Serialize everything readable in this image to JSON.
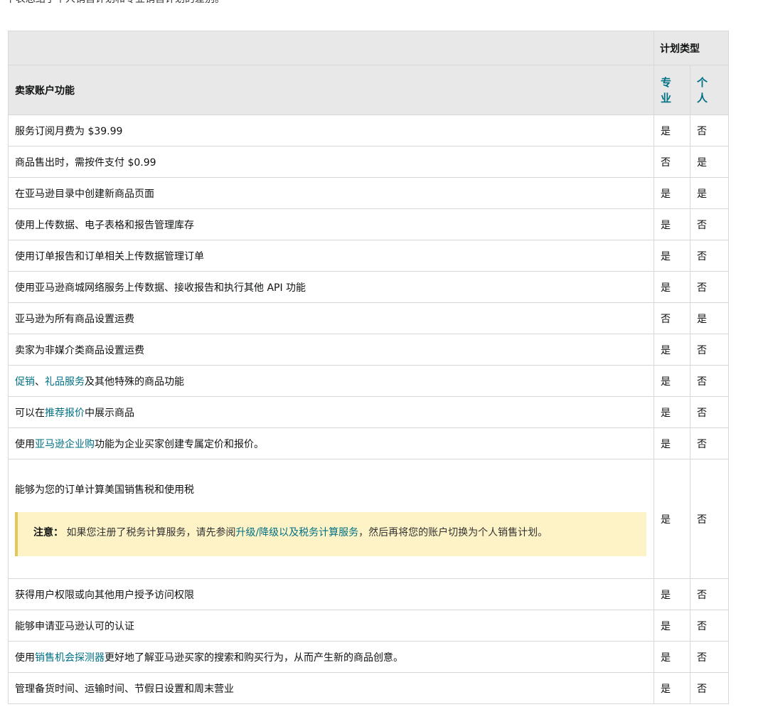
{
  "intro_text": "下表总结了个人销售计划和专业销售计划的差别。",
  "table": {
    "plan_type_header": "计划类型",
    "feature_header": "卖家账户功能",
    "col_professional": "专业",
    "col_individual": "个人",
    "rows": [
      {
        "parts": [
          {
            "text": "服务订阅月费为 $39.99"
          }
        ],
        "pro": "是",
        "ind": "否"
      },
      {
        "parts": [
          {
            "text": "商品售出时，需按件支付 $0.99"
          }
        ],
        "pro": "否",
        "ind": "是"
      },
      {
        "parts": [
          {
            "text": "在亚马逊目录中创建新商品页面"
          }
        ],
        "pro": "是",
        "ind": "是"
      },
      {
        "parts": [
          {
            "text": "使用上传数据、电子表格和报告管理库存"
          }
        ],
        "pro": "是",
        "ind": "否"
      },
      {
        "parts": [
          {
            "text": "使用订单报告和订单相关上传数据管理订单"
          }
        ],
        "pro": "是",
        "ind": "否"
      },
      {
        "parts": [
          {
            "text": "使用亚马逊商城网络服务上传数据、接收报告和执行其他 API 功能"
          }
        ],
        "pro": "是",
        "ind": "否"
      },
      {
        "parts": [
          {
            "text": "亚马逊为所有商品设置运费"
          }
        ],
        "pro": "否",
        "ind": "是"
      },
      {
        "parts": [
          {
            "text": "卖家为非媒介类商品设置运费"
          }
        ],
        "pro": "是",
        "ind": "否"
      },
      {
        "parts": [
          {
            "text": "促销",
            "link": true
          },
          {
            "text": "、"
          },
          {
            "text": "礼品服务",
            "link": true
          },
          {
            "text": "及其他特殊的商品功能"
          }
        ],
        "pro": "是",
        "ind": "否"
      },
      {
        "parts": [
          {
            "text": "可以在"
          },
          {
            "text": "推荐报价",
            "link": true
          },
          {
            "text": "中展示商品"
          }
        ],
        "pro": "是",
        "ind": "否"
      },
      {
        "parts": [
          {
            "text": "使用"
          },
          {
            "text": "亚马逊企业购",
            "link": true
          },
          {
            "text": "功能为企业买家创建专属定价和报价。"
          }
        ],
        "pro": "是",
        "ind": "否"
      },
      {
        "tall": true,
        "parts": [
          {
            "text": "能够为您的订单计算美国销售税和使用税"
          }
        ],
        "note": {
          "label": "注意：",
          "parts": [
            {
              "text": " 如果您注册了税务计算服务，请先参阅"
            },
            {
              "text": "升级/降级以及税务计算服务",
              "link": true
            },
            {
              "text": "，然后再将您的账户切换为个人销售计划。"
            }
          ]
        },
        "pro": "是",
        "ind": "否"
      },
      {
        "parts": [
          {
            "text": "获得用户权限或向其他用户授予访问权限"
          }
        ],
        "pro": "是",
        "ind": "否"
      },
      {
        "parts": [
          {
            "text": "能够申请亚马逊认可的认证"
          }
        ],
        "pro": "是",
        "ind": "否"
      },
      {
        "parts": [
          {
            "text": "使用"
          },
          {
            "text": "销售机会探测器",
            "link": true
          },
          {
            "text": "更好地了解亚马逊买家的搜索和购买行为，从而产生新的商品创意。"
          }
        ],
        "pro": "是",
        "ind": "否"
      },
      {
        "parts": [
          {
            "text": "管理备货时间、运输时间、节假日设置和周末营业"
          }
        ],
        "pro": "是",
        "ind": "否"
      }
    ]
  }
}
